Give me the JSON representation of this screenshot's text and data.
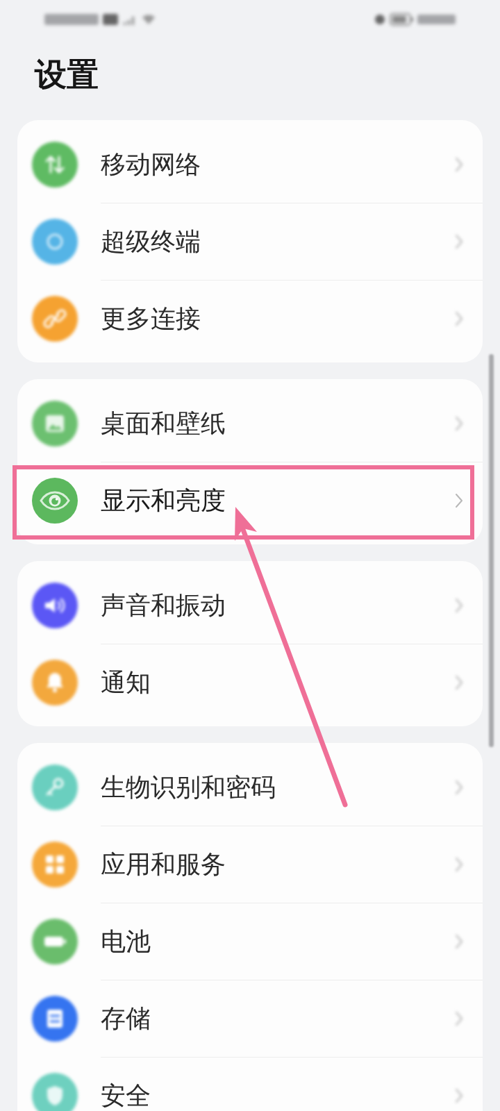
{
  "title": "设置",
  "groups": [
    {
      "items": [
        {
          "label": "移动网络",
          "color": "#5fbb63",
          "highlighted": false
        },
        {
          "label": "超级终端",
          "color": "#55b4e6",
          "highlighted": false
        },
        {
          "label": "更多连接",
          "color": "#f5a231",
          "highlighted": false
        }
      ]
    },
    {
      "items": [
        {
          "label": "桌面和壁纸",
          "color": "#6cc070",
          "highlighted": false
        },
        {
          "label": "显示和亮度",
          "color": "#5cb85e",
          "highlighted": true
        }
      ]
    },
    {
      "items": [
        {
          "label": "声音和振动",
          "color": "#5b57f5",
          "highlighted": false
        },
        {
          "label": "通知",
          "color": "#f3a83d",
          "highlighted": false
        }
      ]
    },
    {
      "items": [
        {
          "label": "生物识别和密码",
          "color": "#6acfbf",
          "highlighted": false
        },
        {
          "label": "应用和服务",
          "color": "#f5a83a",
          "highlighted": false
        },
        {
          "label": "电池",
          "color": "#6abd6c",
          "highlighted": false
        },
        {
          "label": "存储",
          "color": "#3574f0",
          "highlighted": false
        },
        {
          "label": "安全",
          "color": "#6ed0bf",
          "highlighted": false
        }
      ]
    }
  ]
}
